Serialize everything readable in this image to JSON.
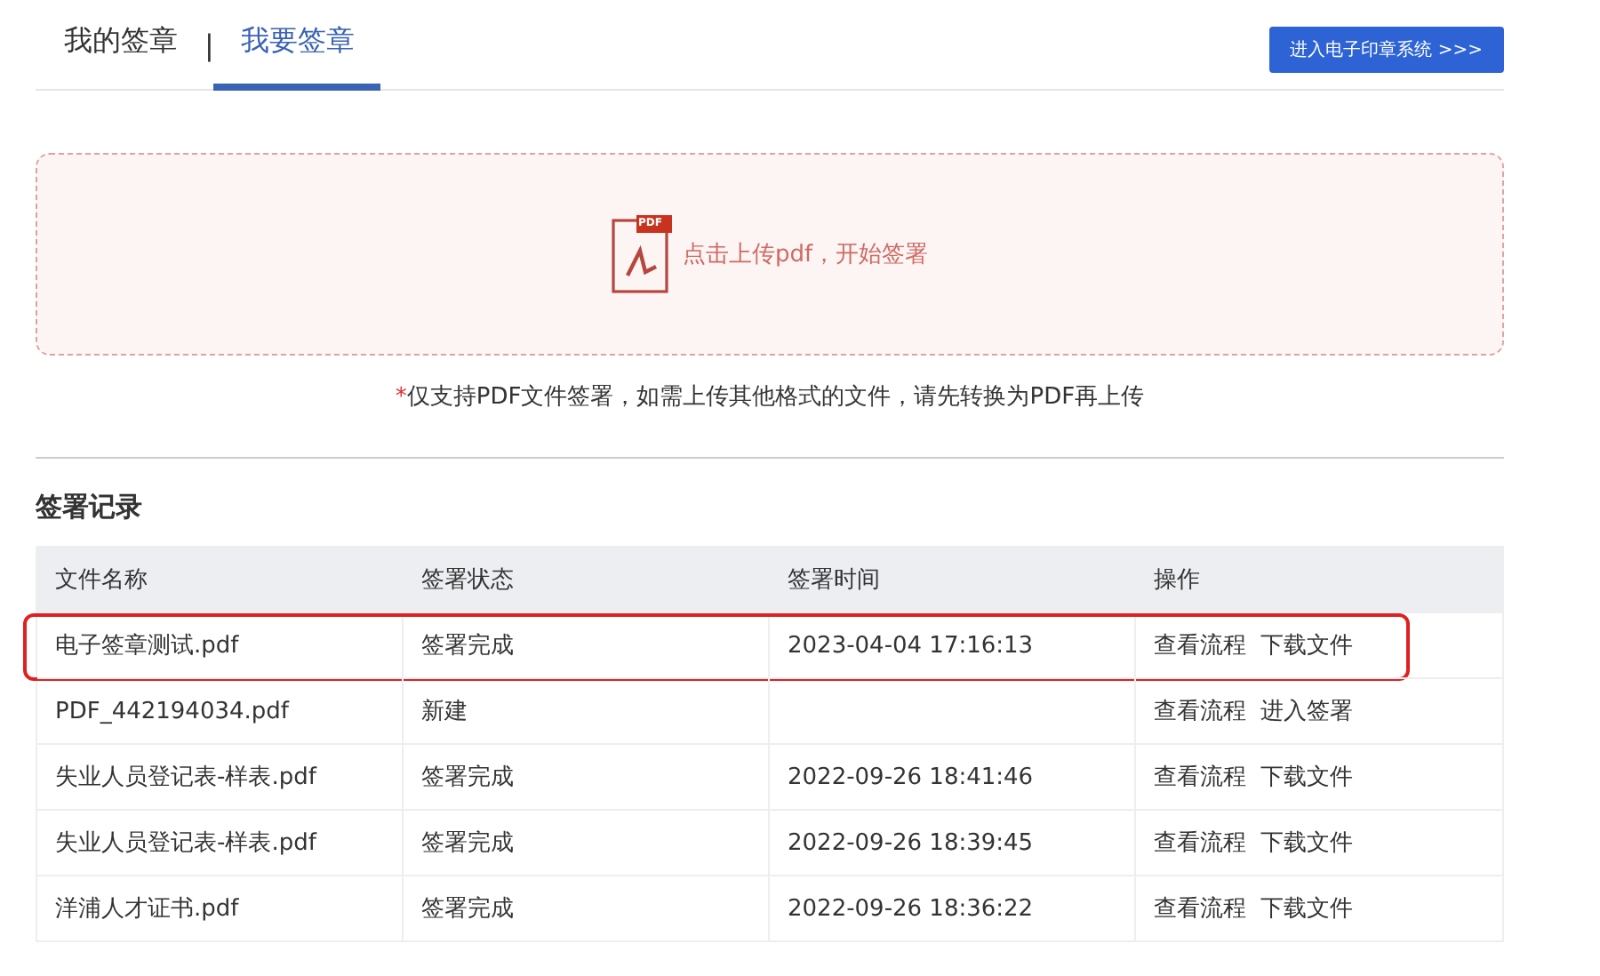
{
  "tabs": [
    {
      "label": "我的签章",
      "selected": false
    },
    {
      "label": "我要签章",
      "selected": true
    }
  ],
  "tab_separator": "|",
  "system_button": "进入电子印章系统 >>>",
  "upload": {
    "icon_label": "PDF",
    "prompt": "点击上传pdf，开始签署"
  },
  "note": {
    "mark": "*",
    "text": "仅支持PDF文件签署，如需上传其他格式的文件，请先转换为PDF再上传"
  },
  "records": {
    "title": "签署记录",
    "columns": [
      "文件名称",
      "签署状态",
      "签署时间",
      "操作"
    ],
    "rows": [
      {
        "name": "电子签章测试.pdf",
        "status": "签署完成",
        "time": "2023-04-04 17:16:13",
        "actions": [
          "查看流程",
          "下载文件"
        ],
        "highlighted": true
      },
      {
        "name": "PDF_442194034.pdf",
        "status": "新建",
        "time": "",
        "actions": [
          "查看流程",
          "进入签署"
        ],
        "highlighted": false
      },
      {
        "name": "失业人员登记表-样表.pdf",
        "status": "签署完成",
        "time": "2022-09-26 18:41:46",
        "actions": [
          "查看流程",
          "下载文件"
        ],
        "highlighted": false
      },
      {
        "name": "失业人员登记表-样表.pdf",
        "status": "签署完成",
        "time": "2022-09-26 18:39:45",
        "actions": [
          "查看流程",
          "下载文件"
        ],
        "highlighted": false
      },
      {
        "name": "洋浦人才证书.pdf",
        "status": "签署完成",
        "time": "2022-09-26 18:36:22",
        "actions": [
          "查看流程",
          "下载文件"
        ],
        "highlighted": false
      }
    ]
  }
}
